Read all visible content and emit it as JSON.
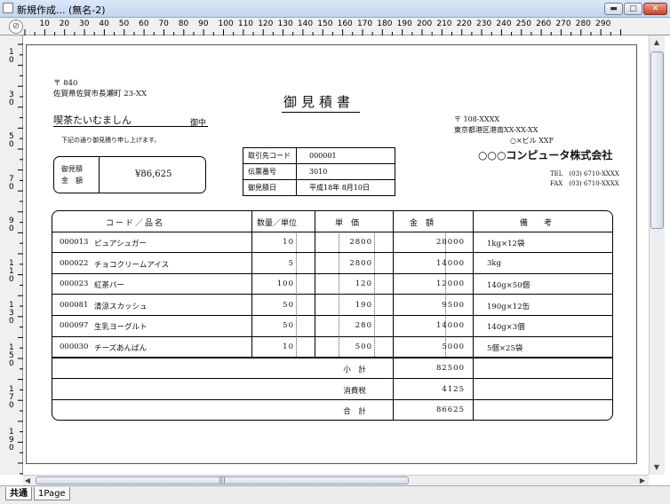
{
  "window": {
    "title": "新規作成... (無名-2)"
  },
  "ruler": {
    "h_labels": [
      "10",
      "20",
      "30",
      "40",
      "50",
      "60",
      "70",
      "80",
      "90",
      "100",
      "110",
      "120",
      "130",
      "140",
      "150",
      "160",
      "170",
      "180",
      "190",
      "200",
      "210",
      "220",
      "230",
      "240",
      "250",
      "260",
      "270",
      "280",
      "290"
    ],
    "v_labels": [
      "10",
      "30",
      "50",
      "70",
      "90",
      "110",
      "130",
      "150",
      "170",
      "190"
    ]
  },
  "tabs": [
    "共通",
    "1Page"
  ],
  "doc": {
    "postal": "〒 840",
    "address": "佐賀県佐賀市長瀬町 23-XX",
    "title": "御見積書",
    "customer": "喫茶たいむましん",
    "honorific": "御中",
    "intro": "下記の通り御見積り申し上げます。",
    "amount_label_1": "御見積",
    "amount_label_2": "金　額",
    "amount_value": "¥86,625",
    "info": [
      {
        "label": "取引先コード",
        "value": "000001"
      },
      {
        "label": "伝票番号",
        "value": "3010"
      },
      {
        "label": "御見積日",
        "value": "平成18年 8月10日"
      }
    ],
    "sender": {
      "postal": "〒 108-XXXX",
      "address": "東京都港区港南XX-XX-XX",
      "building": "○×ビル XXF",
      "company": "○○○コンピュータ株式会社",
      "tel": "TEL　(03) 6710-XXXX",
      "fax": "FAX　(03) 6710-XXXX"
    },
    "table": {
      "headers": [
        "コード／品名",
        "数量／単位",
        "単　価",
        "金　額",
        "備　　考"
      ],
      "rows": [
        {
          "code": "000013",
          "name": "ピュアシュガー",
          "qty": "10",
          "price": "2800",
          "amount": "28000",
          "note": "1kg×12袋"
        },
        {
          "code": "000022",
          "name": "チョコクリームアイス",
          "qty": "5",
          "price": "2800",
          "amount": "14000",
          "note": "3kg"
        },
        {
          "code": "000023",
          "name": "紅茶バー",
          "qty": "100",
          "price": "120",
          "amount": "12000",
          "note": "140g×50個"
        },
        {
          "code": "000081",
          "name": "清涼スカッシュ",
          "qty": "50",
          "price": "190",
          "amount": "9500",
          "note": "190g×12缶"
        },
        {
          "code": "000097",
          "name": "生乳ヨーグルト",
          "qty": "50",
          "price": "280",
          "amount": "14000",
          "note": "140g×3個"
        },
        {
          "code": "000030",
          "name": "チーズあんぱん",
          "qty": "10",
          "price": "500",
          "amount": "5000",
          "note": "5個×25袋"
        }
      ],
      "totals": [
        {
          "label": "小　計",
          "value": "82500"
        },
        {
          "label": "消費税",
          "value": "4125"
        },
        {
          "label": "合　計",
          "value": "86625"
        }
      ]
    }
  }
}
